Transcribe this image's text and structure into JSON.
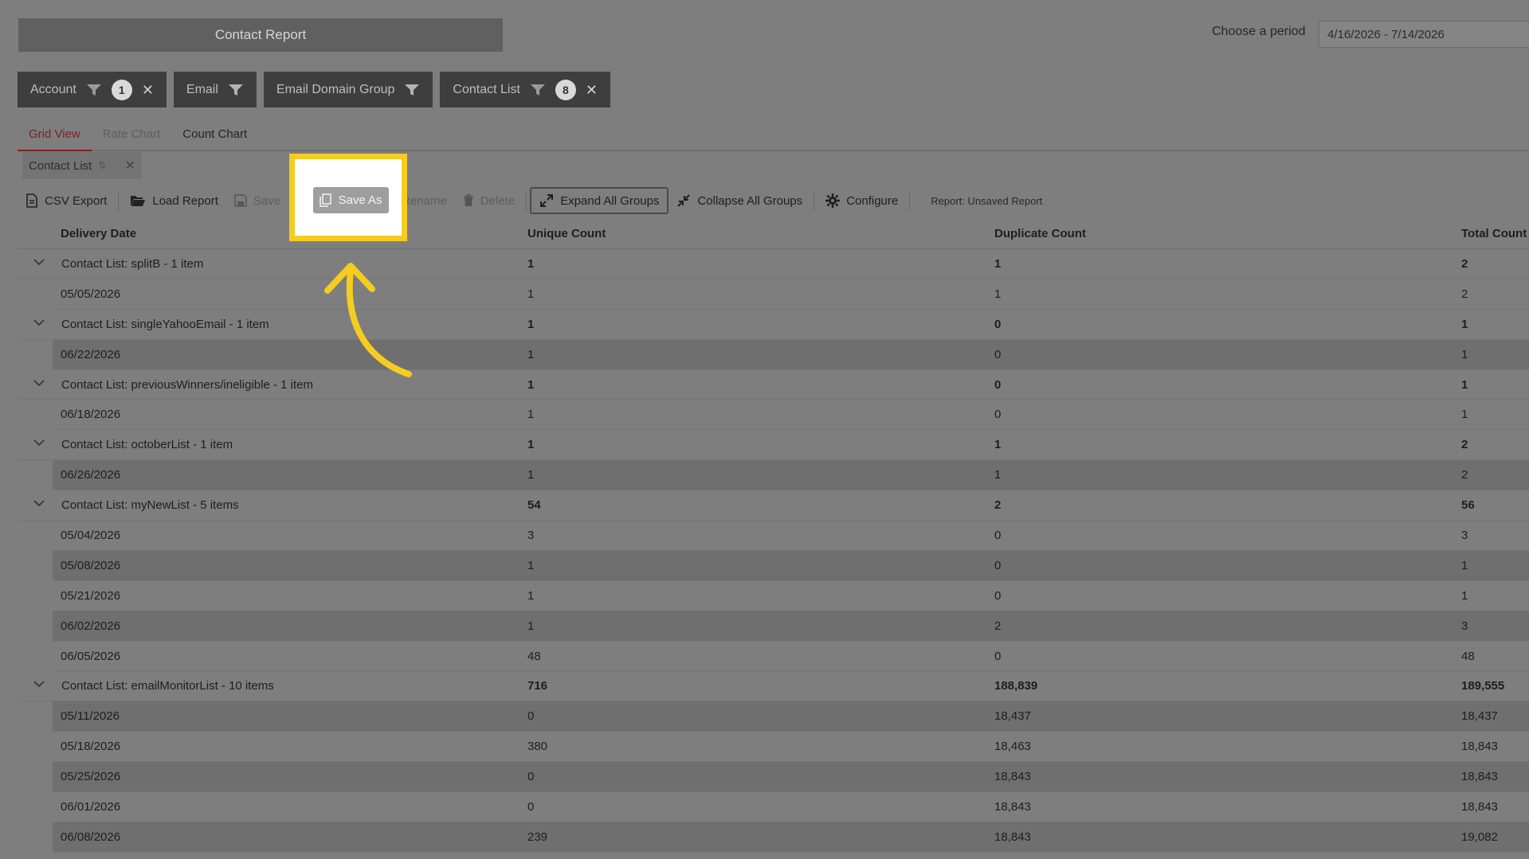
{
  "header": {
    "title": "Contact Report",
    "period_label": "Choose a period",
    "period_value": "4/16/2026 - 7/14/2026"
  },
  "filters": [
    {
      "label": "Account",
      "count": "1",
      "removable": true
    },
    {
      "label": "Email",
      "count": "",
      "removable": false
    },
    {
      "label": "Email Domain Group",
      "count": "",
      "removable": false
    },
    {
      "label": "Contact List",
      "count": "8",
      "removable": true
    }
  ],
  "tabs": [
    "Grid View",
    "Rate Chart",
    "Count Chart"
  ],
  "group_chip": {
    "label": "Contact List"
  },
  "toolbar": {
    "csv_export": "CSV Export",
    "load_report": "Load Report",
    "save": "Save",
    "save_as": "Save As",
    "rename": "Rename",
    "delete": "Delete",
    "expand_all": "Expand All Groups",
    "collapse_all": "Collapse All Groups",
    "configure": "Configure",
    "report_status": "Report: Unsaved Report"
  },
  "columns": [
    "Delivery Date",
    "Unique Count",
    "Duplicate Count",
    "Total Count"
  ],
  "groups": [
    {
      "label": "Contact List: splitB - 1 item",
      "unique": "1",
      "duplicate": "1",
      "total": "2",
      "rows": [
        [
          "05/05/2026",
          "1",
          "1",
          "2"
        ]
      ]
    },
    {
      "label": "Contact List: singleYahooEmail - 1 item",
      "unique": "1",
      "duplicate": "0",
      "total": "1",
      "rows": [
        [
          "06/22/2026",
          "1",
          "0",
          "1"
        ]
      ]
    },
    {
      "label": "Contact List: previousWinners/ineligible - 1 item",
      "unique": "1",
      "duplicate": "0",
      "total": "1",
      "rows": [
        [
          "06/18/2026",
          "1",
          "0",
          "1"
        ]
      ]
    },
    {
      "label": "Contact List: octoberList - 1 item",
      "unique": "1",
      "duplicate": "1",
      "total": "2",
      "rows": [
        [
          "06/26/2026",
          "1",
          "1",
          "2"
        ]
      ]
    },
    {
      "label": "Contact List: myNewList - 5 items",
      "unique": "54",
      "duplicate": "2",
      "total": "56",
      "rows": [
        [
          "05/04/2026",
          "3",
          "0",
          "3"
        ],
        [
          "05/08/2026",
          "1",
          "0",
          "1"
        ],
        [
          "05/21/2026",
          "1",
          "0",
          "1"
        ],
        [
          "06/02/2026",
          "1",
          "2",
          "3"
        ],
        [
          "06/05/2026",
          "48",
          "0",
          "48"
        ]
      ]
    },
    {
      "label": "Contact List: emailMonitorList - 10 items",
      "unique": "716",
      "duplicate": "188,839",
      "total": "189,555",
      "rows": [
        [
          "05/11/2026",
          "0",
          "18,437",
          "18,437"
        ],
        [
          "05/18/2026",
          "380",
          "18,463",
          "18,843"
        ],
        [
          "05/25/2026",
          "0",
          "18,843",
          "18,843"
        ],
        [
          "06/01/2026",
          "0",
          "18,843",
          "18,843"
        ],
        [
          "06/08/2026",
          "239",
          "18,843",
          "19,082"
        ]
      ]
    }
  ]
}
